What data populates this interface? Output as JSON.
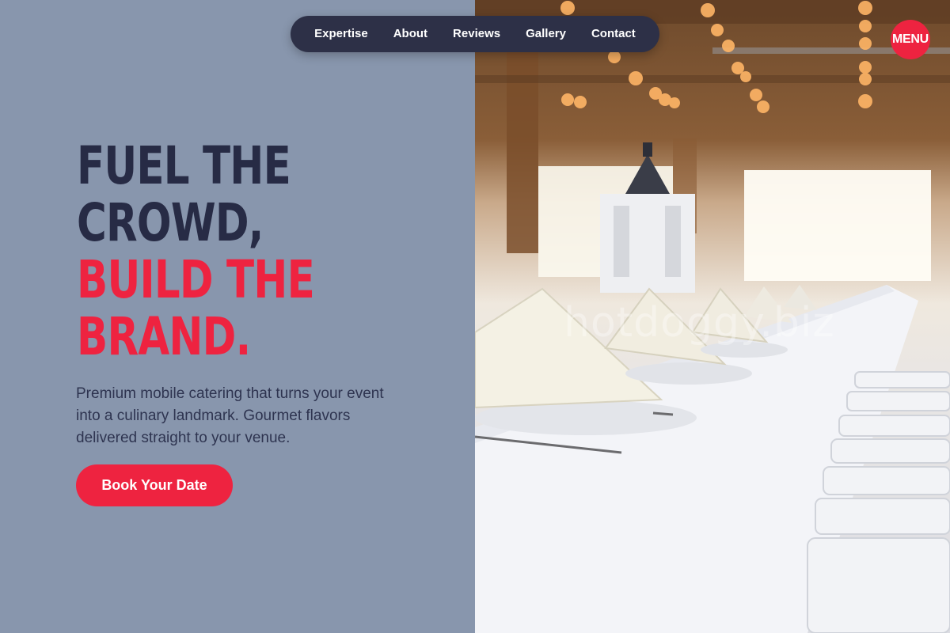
{
  "nav": {
    "items": [
      {
        "label": "Expertise"
      },
      {
        "label": "About"
      },
      {
        "label": "Reviews"
      },
      {
        "label": "Gallery"
      },
      {
        "label": "Contact"
      }
    ],
    "menu_label": "MENU"
  },
  "hero": {
    "headline_line1": "FUEL THE",
    "headline_line2": "CROWD,",
    "headline_line3": "BUILD THE",
    "headline_line4": "BRAND.",
    "subtitle": "Premium mobile catering that turns your event into a culinary landmark. Gourmet flavors delivered straight to your venue.",
    "cta_label": "Book Your Date"
  },
  "photo": {
    "watermark": "hotdoggy.biz"
  },
  "colors": {
    "accent": "#ee2340",
    "dark": "#272b45",
    "panel": "#8896ad",
    "nav_bg": "#2d3047"
  }
}
